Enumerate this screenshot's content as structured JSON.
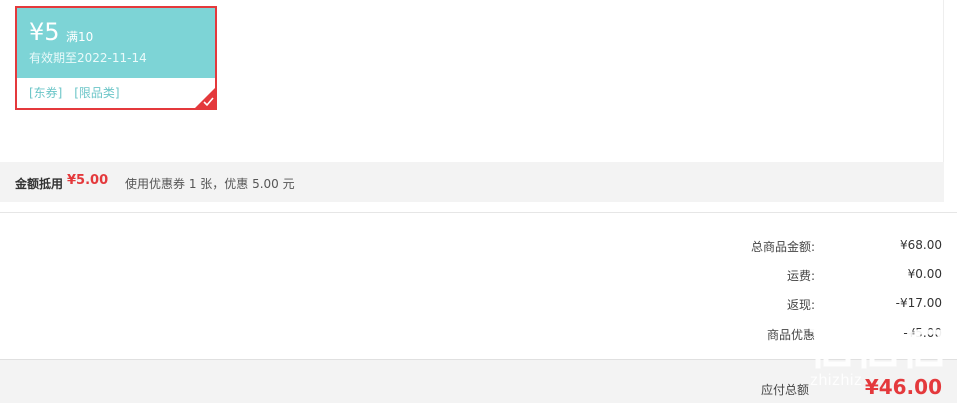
{
  "coupon": {
    "amount": "¥5",
    "threshold": "满10",
    "validity": "有效期至2022-11-14",
    "tags": [
      "[东券]",
      "[限品类]"
    ],
    "selected": true,
    "colors": {
      "accent": "#e4393c",
      "top": "#7dd4d6"
    }
  },
  "deduction": {
    "label": "金额抵用",
    "amount": "¥5.00",
    "description": "使用优惠券 1 张，优惠 5.00 元"
  },
  "summary": {
    "rows": [
      {
        "label": "总商品金额:",
        "value": "¥68.00"
      },
      {
        "label": "运费:",
        "value": "¥0.00"
      },
      {
        "label": "返现:",
        "value": "-¥17.00"
      },
      {
        "label": "商品优惠",
        "value": "-¥5.00"
      }
    ]
  },
  "payable": {
    "label": "应付总额",
    "value": "¥46.00"
  },
  "watermark": {
    "text": "zhizhiz"
  }
}
